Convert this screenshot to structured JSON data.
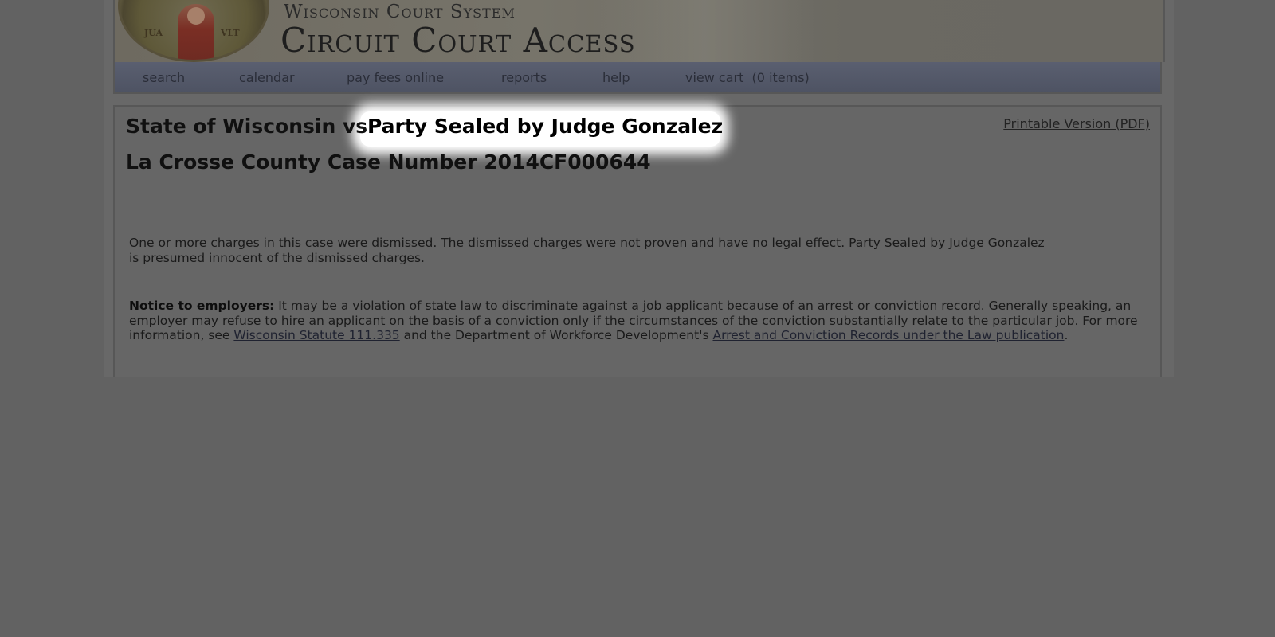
{
  "header": {
    "line1": "Wisconsin Court System",
    "line2": "Circuit Court Access",
    "seal_left": "JUA",
    "seal_right": "VLT"
  },
  "nav": {
    "items": [
      {
        "label": "search"
      },
      {
        "label": "calendar"
      },
      {
        "label": "pay fees online"
      },
      {
        "label": "reports"
      },
      {
        "label": "help"
      },
      {
        "label": "view cart  (0 items)"
      }
    ]
  },
  "case": {
    "title_left": "State of Wisconsin vs.",
    "title_party": "Party Sealed by Judge Gonzalez",
    "case_number": "La Crosse County Case Number 2014CF000644",
    "printable_link": "Printable Version (PDF)"
  },
  "notices": {
    "dismissed": "One or more charges in this case were dismissed. The dismissed charges were not proven and have no legal effect. Party Sealed by Judge Gonzalez is presumed innocent of the dismissed charges.",
    "employers_label": "Notice to employers:",
    "employers_text": " It may be a violation of state law to discriminate against a job applicant because of an arrest or conviction record. Generally speaking, an employer may refuse to hire an applicant on the basis of a conviction only if the circumstances of the conviction substantially relate to the particular job. For more information, see ",
    "statute_link": "Wisconsin Statute 111.335",
    "middle_text": " and the Department of Workforce Development's ",
    "publication_link": "Arrest and Conviction Records under the Law publication",
    "end_text": "."
  }
}
